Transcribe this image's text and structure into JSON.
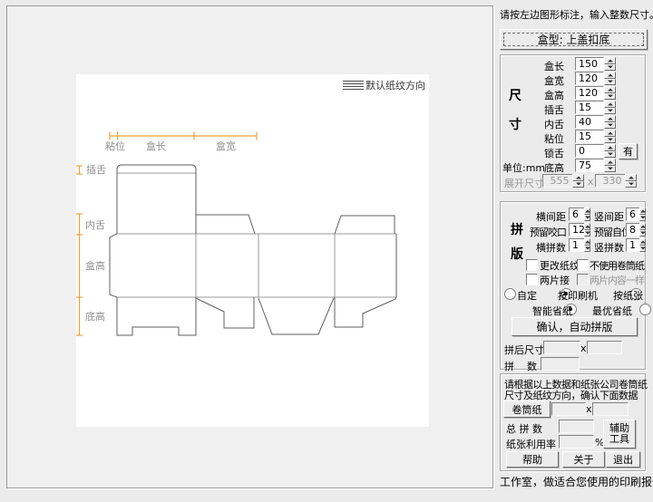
{
  "header": {
    "instruction": "请按左边图形标注，输入整数尺寸。"
  },
  "box_type_button": {
    "label": "盒型: 上盖扣底"
  },
  "canvas": {
    "grain": {
      "label": "默认纸纹方向"
    },
    "top_dims": {
      "glue": "粘位",
      "length": "盒长",
      "width": "盒宽"
    },
    "left_dims": {
      "tuck": "插舌",
      "dust": "内舌",
      "height": "盒高",
      "bottom": "底高"
    },
    "accent_color": "#f0a23c",
    "line_color": "#5f5f5f"
  },
  "size_panel": {
    "title_char1": "尺",
    "title_char2": "寸",
    "unit_label": "单位:mm",
    "rows": [
      {
        "label": "盒长",
        "value": "150"
      },
      {
        "label": "盒宽",
        "value": "120"
      },
      {
        "label": "盒高",
        "value": "120"
      },
      {
        "label": "插舌",
        "value": "15"
      },
      {
        "label": "内舌",
        "value": "40"
      },
      {
        "label": "粘位",
        "value": "15"
      },
      {
        "label": "锁舌",
        "value": "0"
      },
      {
        "label": "底高",
        "value": "75"
      }
    ],
    "lock_toggle_button": "有",
    "unfold": {
      "label": "展开尺寸",
      "width": "555",
      "times": "x",
      "height": "330"
    }
  },
  "impose_panel": {
    "title_char1": "拼",
    "title_char2": "版",
    "pairs": [
      {
        "l1": "横间距",
        "v1": "6",
        "l2": "竖间距",
        "v2": "6"
      },
      {
        "l1": "预留咬口",
        "v1": "12",
        "l2": "预留自位",
        "v2": "8"
      },
      {
        "l1": "横拼数",
        "v1": "1",
        "l2": "竖拼数",
        "v2": "1"
      }
    ],
    "checkboxes": {
      "change_grain": "更改纸纹",
      "no_roll": "不使用卷筒纸",
      "two_piece": "两片接",
      "two_same": "两片内容一样"
    },
    "radios": {
      "custom": "自定",
      "by_press": "按印刷机",
      "by_sheet": "按纸张",
      "smart_save": "智能省纸",
      "best_save": "最优省纸"
    },
    "confirm_button": "确认，自动拼版",
    "result_size_label": "拼后尺寸",
    "times": "x",
    "result_count_label": "拼    数"
  },
  "paper_panel": {
    "note1": "请根据以上数据和纸张公司卷筒纸",
    "note2": "尺寸及纸纹方向，确认下面数据",
    "roll_button": "卷筒纸",
    "times": "x",
    "total_label": "总 拼 数",
    "usage_label": "纸张利用率",
    "percent": "%",
    "tools_line1": "辅助",
    "tools_line2": "工具",
    "help_button": "帮助",
    "about_button": "关于",
    "exit_button": "退出"
  },
  "status_bar": {
    "text": "工作室，做适合您使用的印刷报价软件"
  }
}
